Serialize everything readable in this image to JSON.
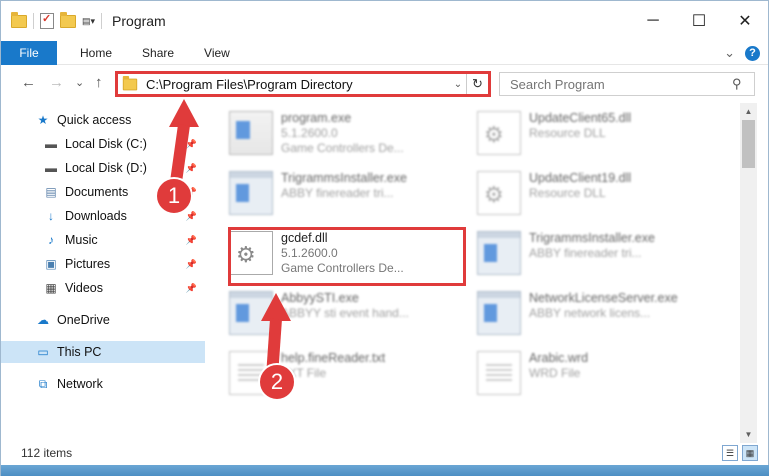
{
  "window": {
    "title": "Program",
    "minimize_glyph": "─",
    "maximize_glyph": "☐",
    "close_glyph": "✕"
  },
  "ribbon": {
    "tabs": [
      "File",
      "Home",
      "Share",
      "View"
    ],
    "help_glyph": "?",
    "collapse_glyph": "⌄"
  },
  "address": {
    "back_glyph": "←",
    "forward_glyph": "→",
    "recent_glyph": "⌄",
    "up_glyph": "↑",
    "path": "C:\\Program Files\\Program Directory",
    "dropdown_glyph": "⌄",
    "refresh_glyph": "↻"
  },
  "search": {
    "placeholder": "Search Program",
    "icon_glyph": "⚲"
  },
  "sidebar": {
    "items": [
      {
        "label": "Quick access",
        "icon": "star-icon",
        "glyph": "★",
        "color": "#1979ca",
        "pinned": false
      },
      {
        "label": "Local Disk (C:)",
        "icon": "drive-icon",
        "glyph": "▬",
        "color": "#555555",
        "pinned": true
      },
      {
        "label": "Local Disk (D:)",
        "icon": "drive-icon",
        "glyph": "▬",
        "color": "#555555",
        "pinned": true
      },
      {
        "label": "Documents",
        "icon": "documents-icon",
        "glyph": "▤",
        "color": "#5a7fa8",
        "pinned": true
      },
      {
        "label": "Downloads",
        "icon": "downloads-icon",
        "glyph": "↓",
        "color": "#1979ca",
        "pinned": true
      },
      {
        "label": "Music",
        "icon": "music-icon",
        "glyph": "♪",
        "color": "#1979ca",
        "pinned": true
      },
      {
        "label": "Pictures",
        "icon": "pictures-icon",
        "glyph": "▣",
        "color": "#4a7fb0",
        "pinned": true
      },
      {
        "label": "Videos",
        "icon": "videos-icon",
        "glyph": "▦",
        "color": "#444444",
        "pinned": true
      },
      {
        "label": "OneDrive",
        "icon": "cloud-icon",
        "glyph": "☁",
        "color": "#1979ca",
        "pinned": false
      },
      {
        "label": "This PC",
        "icon": "computer-icon",
        "glyph": "▭",
        "color": "#1979ca",
        "pinned": false
      },
      {
        "label": "Network",
        "icon": "network-icon",
        "glyph": "⧉",
        "color": "#1979ca",
        "pinned": false
      }
    ],
    "pin_glyph": "📌"
  },
  "files": [
    {
      "name": "program.exe",
      "line2": "5.1.2600.0",
      "line3": "Game Controllers De...",
      "icon": "exe",
      "blurred": true
    },
    {
      "name": "UpdateClient65.dll",
      "line2": "Resource DLL",
      "line3": "",
      "icon": "dll",
      "blurred": true
    },
    {
      "name": "TrigrammsInstaller.exe",
      "line2": "ABBY finereader tri...",
      "line3": "",
      "icon": "win",
      "blurred": true
    },
    {
      "name": "UpdateClient19.dll",
      "line2": "Resource DLL",
      "line3": "",
      "icon": "dll",
      "blurred": true
    },
    {
      "name": "gcdef.dll",
      "line2": "5.1.2600.0",
      "line3": "Game Controllers De...",
      "icon": "dll",
      "blurred": false
    },
    {
      "name": "TrigrammsInstaller.exe",
      "line2": "ABBY finereader tri...",
      "line3": "",
      "icon": "win",
      "blurred": true
    },
    {
      "name": "AbbyySTI.exe",
      "line2": "ABBYY sti event hand...",
      "line3": "",
      "icon": "win",
      "blurred": true
    },
    {
      "name": "NetworkLicenseServer.exe",
      "line2": "ABBY network licens...",
      "line3": "",
      "icon": "win",
      "blurred": true
    },
    {
      "name": "help.fineReader.txt",
      "line2": "TXT File",
      "line3": "",
      "icon": "doc",
      "blurred": true
    },
    {
      "name": "Arabic.wrd",
      "line2": "WRD File",
      "line3": "",
      "icon": "doc",
      "blurred": true
    }
  ],
  "status": {
    "item_count": "112 items"
  },
  "annotations": {
    "marker1": "1",
    "marker2": "2",
    "color": "#e03b3b"
  }
}
